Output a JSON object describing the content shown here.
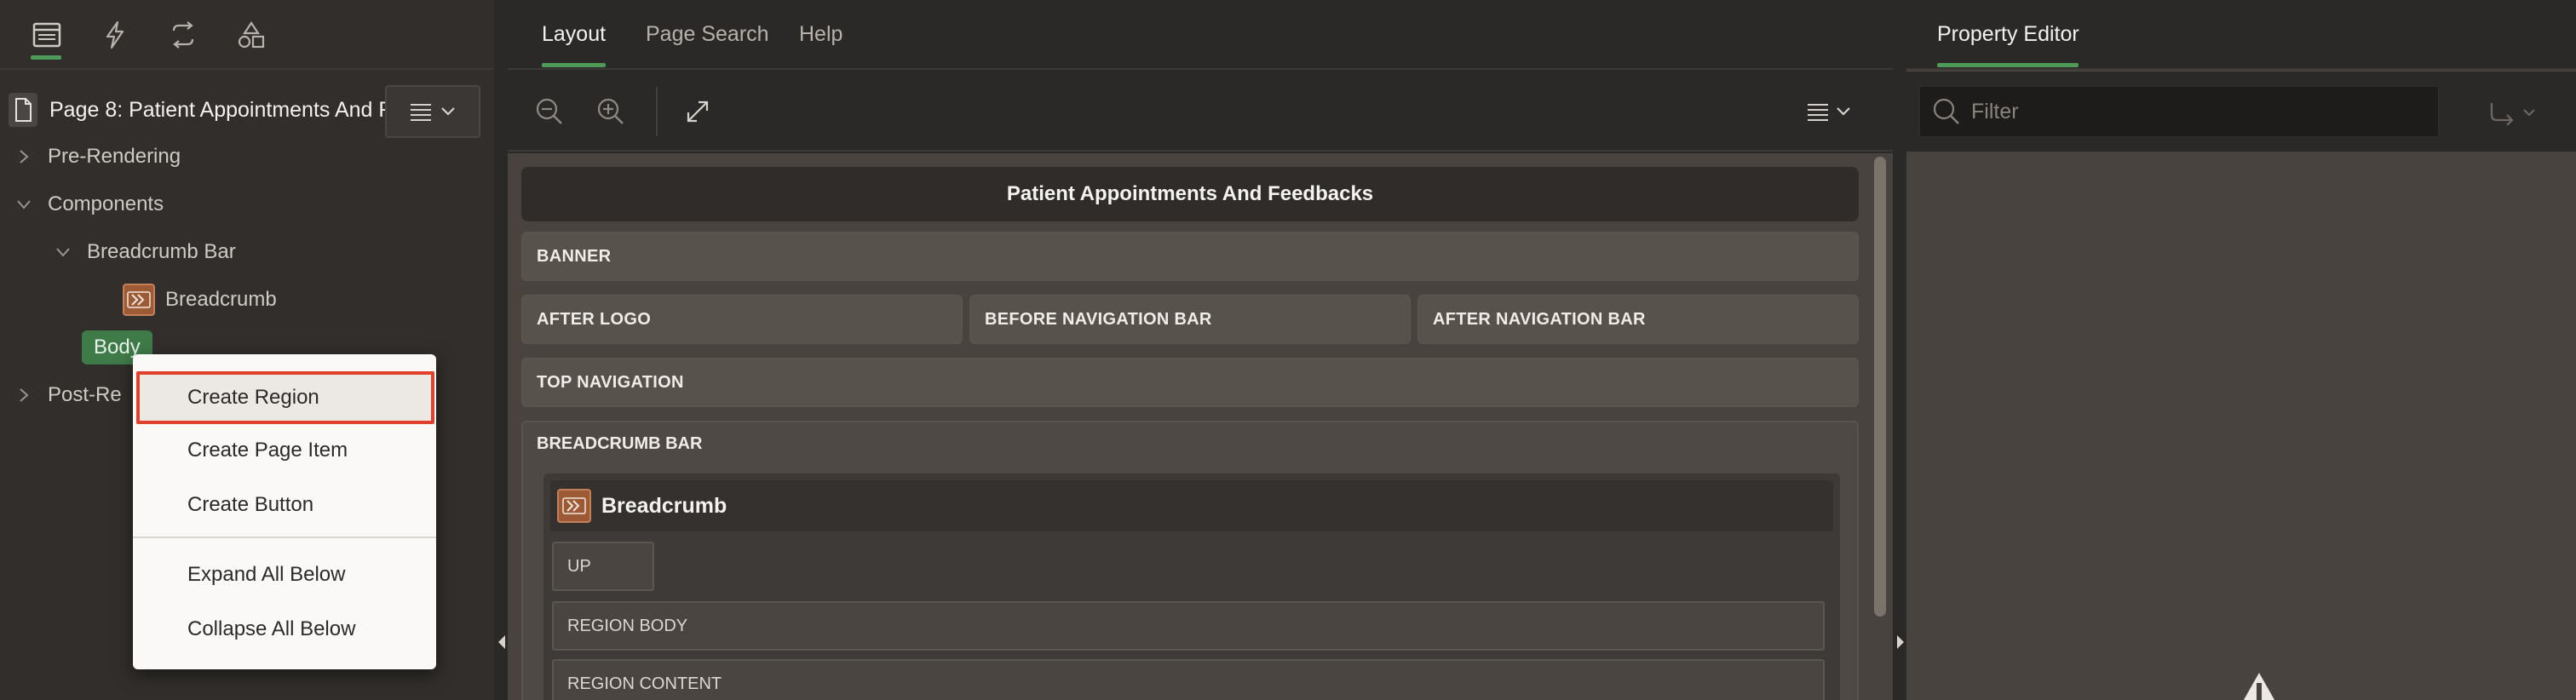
{
  "left_panel": {
    "tabs": [
      {
        "icon": "rendering-tree-icon",
        "active": true
      },
      {
        "icon": "dynamic-actions-icon",
        "active": false
      },
      {
        "icon": "processing-icon",
        "active": false
      },
      {
        "icon": "shared-components-icon",
        "active": false
      }
    ],
    "tree": {
      "root_label": "Page 8: Patient Appointments And F",
      "pre_rendering": "Pre-Rendering",
      "components": "Components",
      "breadcrumb_bar": "Breadcrumb Bar",
      "breadcrumb": "Breadcrumb",
      "body": "Body",
      "post_rendering": "Post-Re"
    },
    "context_menu": {
      "items": [
        "Create Region",
        "Create Page Item",
        "Create Button",
        "Expand All Below",
        "Collapse All Below"
      ],
      "active_item": "Create Region"
    }
  },
  "center_panel": {
    "tabs": [
      "Layout",
      "Page Search",
      "Help"
    ],
    "active_tab": "Layout",
    "page_title": "Patient Appointments And Feedbacks",
    "slots": {
      "banner": "BANNER",
      "after_logo": "AFTER LOGO",
      "before_navigation_bar": "BEFORE NAVIGATION BAR",
      "after_navigation_bar": "AFTER NAVIGATION BAR",
      "top_navigation": "TOP NAVIGATION",
      "breadcrumb_bar": "BREADCRUMB BAR"
    },
    "breadcrumb_region": {
      "title": "Breadcrumb",
      "up": "UP",
      "region_body": "REGION BODY",
      "region_content": "REGION CONTENT"
    }
  },
  "right_panel": {
    "tab": "Property Editor",
    "filter_placeholder": "Filter"
  },
  "colors": {
    "accent_green": "#4e9a59",
    "highlight_red": "#e0412c",
    "breadcrumb_icon": "#9c5a35"
  }
}
